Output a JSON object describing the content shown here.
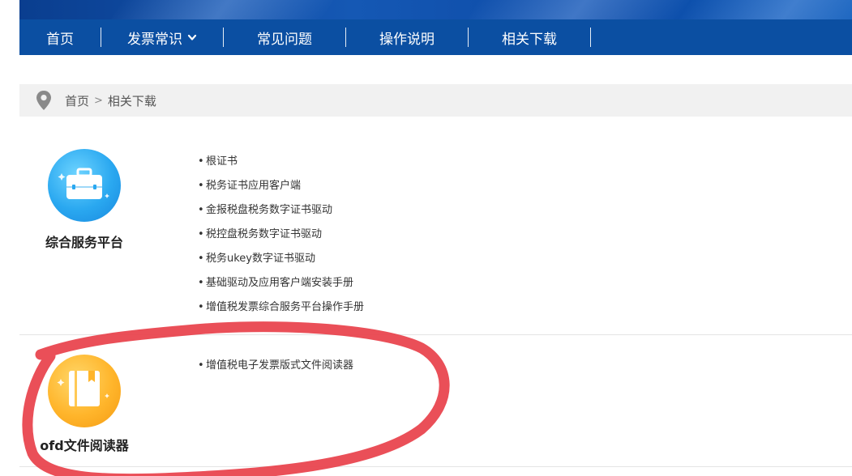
{
  "nav": {
    "items": [
      {
        "label": "首页"
      },
      {
        "label": "发票常识",
        "has_dropdown": true
      },
      {
        "label": "常见问题"
      },
      {
        "label": "操作说明"
      },
      {
        "label": "相关下载"
      }
    ]
  },
  "breadcrumb": {
    "home": "首页",
    "separator": ">",
    "current": "相关下载"
  },
  "sections": [
    {
      "title": "综合服务平台",
      "icon": "briefcase-icon",
      "icon_color": "#2aa8f0",
      "links": [
        "根证书",
        "税务证书应用客户端",
        "金报税盘税务数字证书驱动",
        "税控盘税务数字证书驱动",
        "税务ukey数字证书驱动",
        "基础驱动及应用客户端安装手册",
        "增值税发票综合服务平台操作手册"
      ]
    },
    {
      "title": "ofd文件阅读器",
      "icon": "book-icon",
      "icon_color": "#ffb52b",
      "links": [
        "增值税电子发票版式文件阅读器"
      ]
    }
  ],
  "colors": {
    "nav_bg": "#0b4fa2",
    "breadcrumb_bg": "#f1f1f1",
    "annotation_red": "#e8404a"
  }
}
